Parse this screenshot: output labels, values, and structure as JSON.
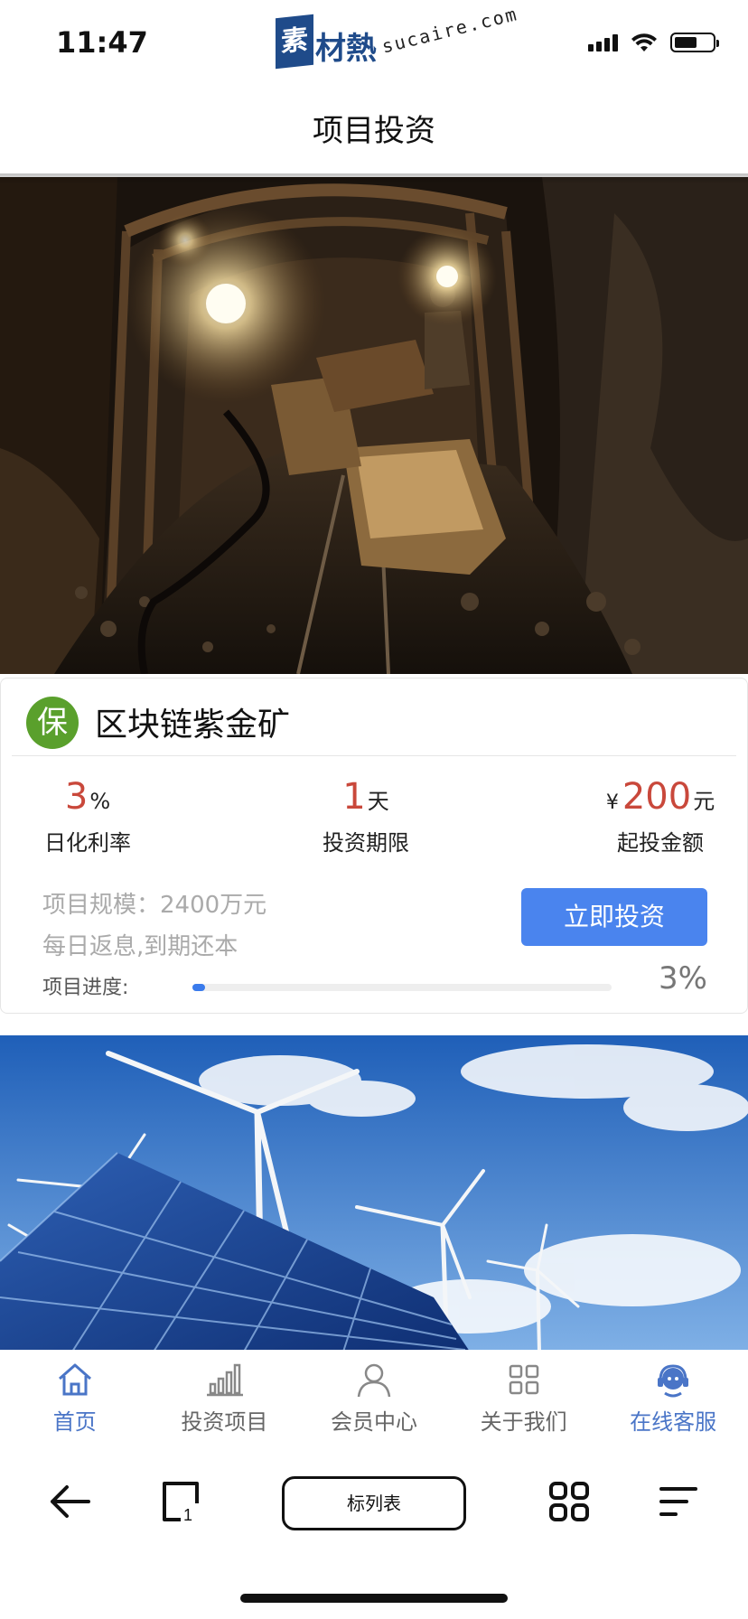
{
  "status_bar": {
    "time": "11:47"
  },
  "watermark": {
    "box_char": "素",
    "cn": "材熱",
    "en": "sucaire.com"
  },
  "header": {
    "title": "项目投资"
  },
  "product": {
    "badge": "保",
    "title": "区块链紫金矿",
    "daily_rate": {
      "value": "3",
      "unit": "%",
      "label": "日化利率"
    },
    "term": {
      "value": "1",
      "unit": "天",
      "label": "投资期限"
    },
    "min_amount": {
      "currency": "¥",
      "value": "200",
      "unit": "元",
      "label": "起投金额"
    },
    "scale": "项目规模：2400万元",
    "repayment": "每日返息,到期还本",
    "invest_button": "立即投资",
    "progress_label": "项目进度:",
    "progress_value": "3%",
    "progress_fraction": 0.03
  },
  "tabbar": {
    "items": [
      {
        "label": "首页",
        "icon": "home-icon"
      },
      {
        "label": "投资项目",
        "icon": "bar-chart-icon"
      },
      {
        "label": "会员中心",
        "icon": "person-icon"
      },
      {
        "label": "关于我们",
        "icon": "grid-icon"
      },
      {
        "label": "在线客服",
        "icon": "headset-icon"
      }
    ]
  },
  "browser": {
    "url_label": "标列表"
  },
  "colors": {
    "accent": "#4a84ee",
    "rate_red": "#c9483b",
    "badge_green": "#5aa02c",
    "tab_active": "#4a75c7"
  }
}
